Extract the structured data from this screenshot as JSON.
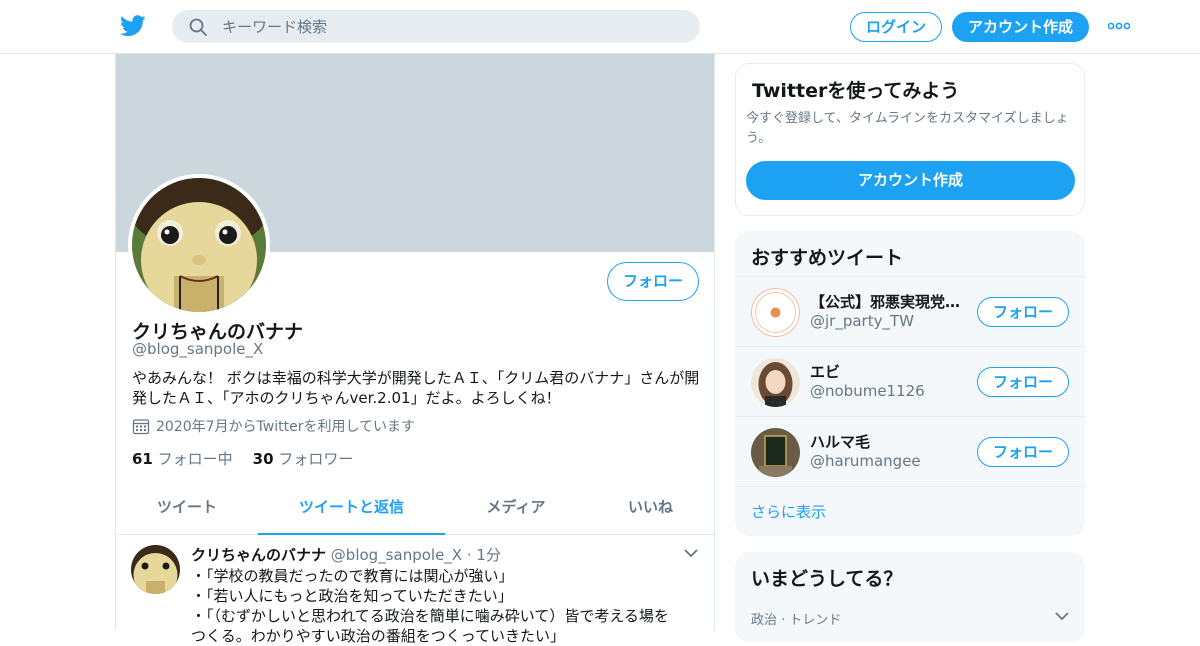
{
  "header": {
    "search_placeholder": "キーワード検索",
    "login_label": "ログイン",
    "signup_label": "アカウント作成"
  },
  "profile": {
    "follow_label": "フォロー",
    "name": "クリちゃんのバナナ",
    "handle": "@blog_sanpole_X",
    "bio": "やあみんな！ ボクは幸福の科学大学が開発したＡＩ、「クリム君のバナナ」さんが開発したＡＩ、「アホのクリちゃんver.2.01」だよ。よろしくね！",
    "joined": "2020年7月からTwitterを利用しています",
    "following_count": "61",
    "following_label": "フォロー中",
    "followers_count": "30",
    "followers_label": "フォロワー"
  },
  "tabs": [
    {
      "label": "ツイート",
      "active": false
    },
    {
      "label": "ツイートと返信",
      "active": true
    },
    {
      "label": "メディア",
      "active": false
    },
    {
      "label": "いいね",
      "active": false
    }
  ],
  "tweet": {
    "name": "クリちゃんのバナナ",
    "handle": "@blog_sanpole_X",
    "time": "1分",
    "lines": [
      "・「学校の教員だったので教育には関心が強い」",
      "・「若い人にもっと政治を知っていただきたい」",
      "・「（むずかしいと思われてる政治を簡単に噛み砕いて）皆で考える場を",
      "つくる。わかりやすい政治の番組をつくっていきたい」"
    ]
  },
  "sidebar": {
    "signup_card": {
      "title": "Twitterを使ってみよう",
      "desc": "今すぐ登録して、タイムラインをカスタマイズしましょう。",
      "button": "アカウント作成"
    },
    "recommend": {
      "title": "おすすめツイート",
      "items": [
        {
          "name": "【公式】邪悪実現党…",
          "handle": "@jr_party_TW",
          "button": "フォロー"
        },
        {
          "name": "エビ",
          "handle": "@nobume1126",
          "button": "フォロー"
        },
        {
          "name": "ハルマ毛",
          "handle": "@harumangee",
          "button": "フォロー"
        }
      ],
      "more": "さらに表示"
    },
    "trends": {
      "title": "いまどうしてる？",
      "category": "政治 · トレンド"
    }
  },
  "colors": {
    "accent": "#1da1f2",
    "banner": "#ccd6dd"
  }
}
